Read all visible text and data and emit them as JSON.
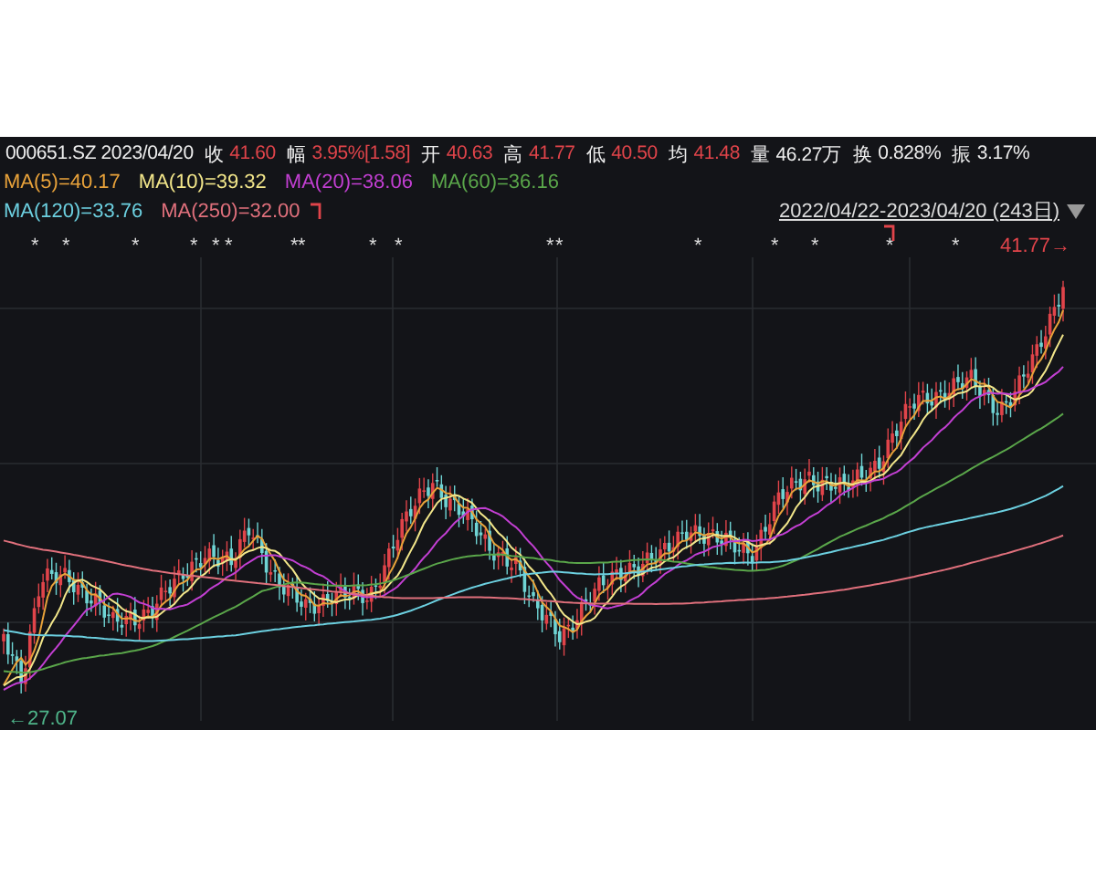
{
  "quote": {
    "symbol_date": "000651.SZ 2023/04/20",
    "fields": [
      {
        "label": "收",
        "value": "41.60",
        "kind": "up"
      },
      {
        "label": "幅",
        "value": "3.95%[1.58]",
        "kind": "up"
      },
      {
        "label": "开",
        "value": "40.63",
        "kind": "up"
      },
      {
        "label": "高",
        "value": "41.77",
        "kind": "up"
      },
      {
        "label": "低",
        "value": "40.50",
        "kind": "up"
      },
      {
        "label": "均",
        "value": "41.48",
        "kind": "up"
      },
      {
        "label": "量",
        "value": "46.27万",
        "kind": "plain"
      },
      {
        "label": "换",
        "value": "0.828%",
        "kind": "plain"
      },
      {
        "label": "振",
        "value": "3.17%",
        "kind": "plain"
      }
    ]
  },
  "ma_lines": [
    {
      "label": "MA(5)=40.17",
      "color": "#e8a23a"
    },
    {
      "label": "MA(10)=39.32",
      "color": "#f2e68a"
    },
    {
      "label": "MA(20)=38.06",
      "color": "#c23fd2"
    },
    {
      "label": "MA(60)=36.16",
      "color": "#5aa64a"
    },
    {
      "label": "MA(120)=33.76",
      "color": "#6cd0e0"
    },
    {
      "label": "MA(250)=32.00",
      "color": "#e0707c"
    }
  ],
  "range": {
    "label": "2022/04/22-2023/04/20 (243日)"
  },
  "markers": [
    "*",
    "*",
    "*",
    "*",
    "*",
    "*",
    "*",
    "*",
    "*",
    "*",
    "*",
    "*",
    "*",
    "*",
    "*",
    "*",
    "*"
  ],
  "chart": {
    "high_label": "41.77→",
    "low_label": "←27.07"
  }
}
